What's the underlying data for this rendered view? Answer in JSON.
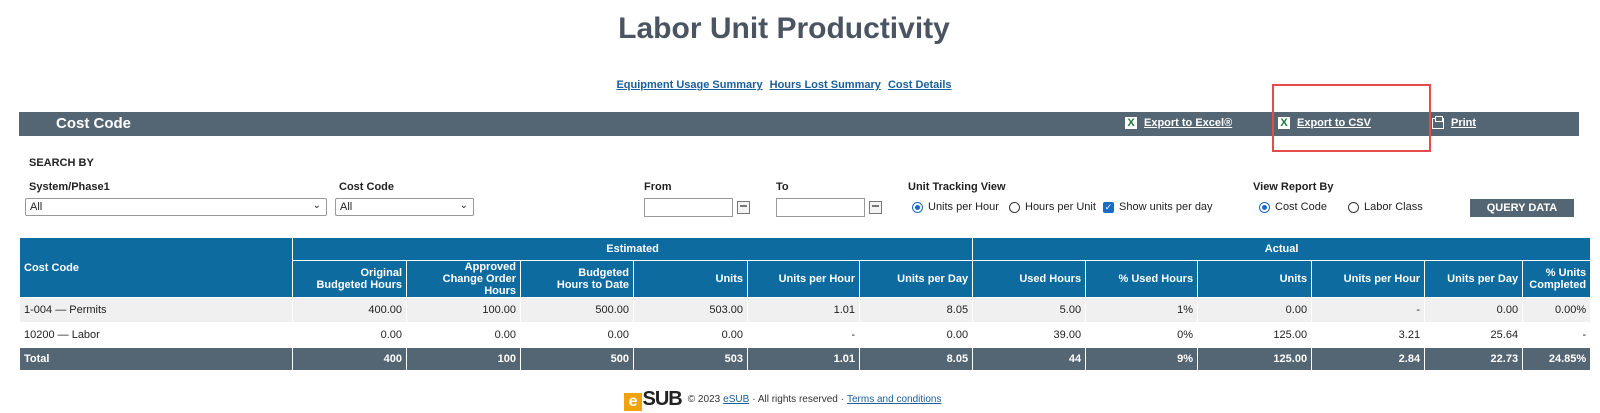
{
  "page": {
    "title": "Labor Unit Productivity"
  },
  "top_links": [
    "Equipment Usage Summary",
    "Hours Lost Summary",
    "Cost Details"
  ],
  "header_bar": {
    "title": "Cost Code",
    "export_excel": "Export to Excel®",
    "export_csv": "Export to CSV",
    "print": "Print",
    "color": "#546673"
  },
  "filters": {
    "search_by": "SEARCH BY",
    "system_phase_label": "System/Phase1",
    "system_phase_value": "All",
    "cost_code_label": "Cost Code",
    "cost_code_value": "All",
    "from_label": "From",
    "from_value": "",
    "to_label": "To",
    "to_value": "",
    "unit_tracking_label": "Unit Tracking View",
    "units_per_hour": "Units per Hour",
    "hours_per_unit": "Hours per Unit",
    "show_units_per_day": "Show units per day",
    "view_report_by_label": "View Report By",
    "view_cost_code": "Cost Code",
    "view_labor_class": "Labor Class",
    "query_button": "QUERY DATA"
  },
  "table": {
    "col_cost_code": "Cost Code",
    "group_estimated": "Estimated",
    "group_actual": "Actual",
    "headers": {
      "est_original_l1": "Original",
      "est_original_l2": "Budgeted Hours",
      "est_approved_l1": "Approved",
      "est_approved_l2": "Change Order Hours",
      "est_budgeted_l1": "Budgeted",
      "est_budgeted_l2": "Hours to Date",
      "est_units": "Units",
      "est_uph": "Units per Hour",
      "est_upd": "Units per Day",
      "act_used_hours": "Used Hours",
      "act_pct_used": "% Used Hours",
      "act_units": "Units",
      "act_uph": "Units per Hour",
      "act_upd": "Units per Day",
      "act_pct_units_l1": "% Units",
      "act_pct_units_l2": "Completed"
    },
    "rows": [
      {
        "cost_code": "1-004 — Permits",
        "orig": "400.00",
        "approved": "100.00",
        "budgeted": "500.00",
        "units": "503.00",
        "uph": "1.01",
        "upd": "8.05",
        "used": "5.00",
        "pct_used": "1%",
        "a_units": "0.00",
        "a_uph": "-",
        "a_upd": "0.00",
        "pct_units": "0.00%"
      },
      {
        "cost_code": "10200 — Labor",
        "orig": "0.00",
        "approved": "0.00",
        "budgeted": "0.00",
        "units": "0.00",
        "uph": "-",
        "upd": "0.00",
        "used": "39.00",
        "pct_used": "0%",
        "a_units": "125.00",
        "a_uph": "3.21",
        "a_upd": "25.64",
        "pct_units": "-"
      }
    ],
    "total": {
      "cost_code": "Total",
      "orig": "400",
      "approved": "100",
      "budgeted": "500",
      "units": "503",
      "uph": "1.01",
      "upd": "8.05",
      "used": "44",
      "pct_used": "9%",
      "a_units": "125.00",
      "a_uph": "2.84",
      "a_upd": "22.73",
      "pct_units": "24.85%"
    }
  },
  "footer": {
    "logo_e": "e",
    "logo_sub": "SUB",
    "copyright": "© 2023",
    "company_link": "eSUB",
    "rights": "· All rights reserved ·",
    "terms_link": "Terms and conditions"
  }
}
